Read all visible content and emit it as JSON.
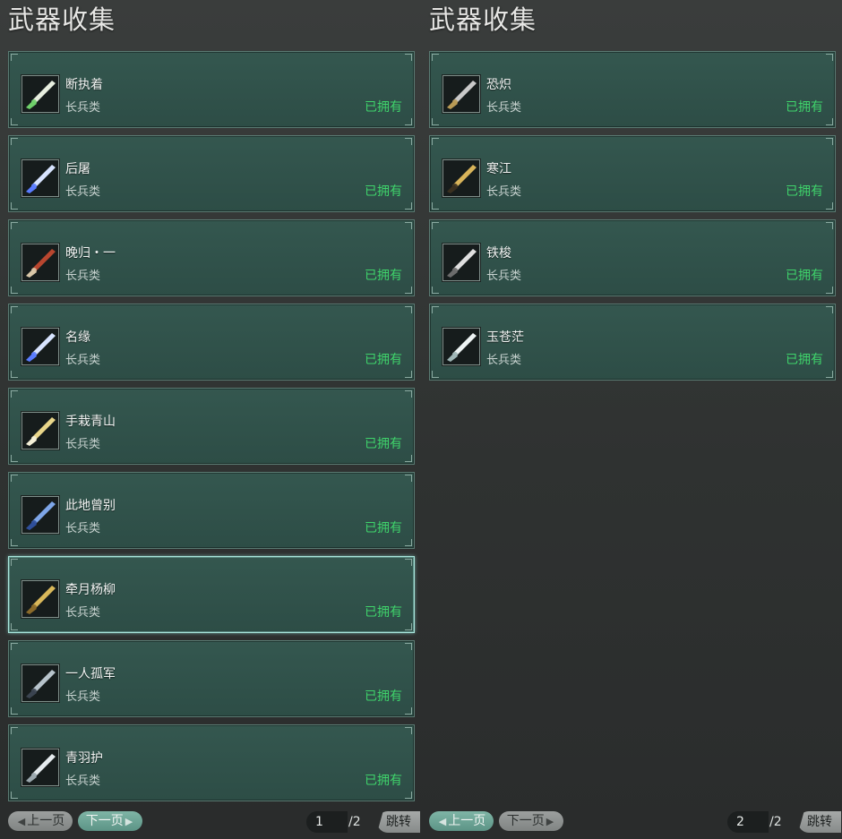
{
  "left_panel": {
    "title": "武器收集",
    "items": [
      {
        "name": "断执着",
        "category": "长兵类",
        "status": "已拥有",
        "icon": "green-bone-blade-icon",
        "selected": false
      },
      {
        "name": "后屠",
        "category": "长兵类",
        "status": "已拥有",
        "icon": "blue-crystal-blade-icon",
        "selected": false
      },
      {
        "name": "晚归・一",
        "category": "长兵类",
        "status": "已拥有",
        "icon": "red-axe-icon",
        "selected": false
      },
      {
        "name": "名缘",
        "category": "长兵类",
        "status": "已拥有",
        "icon": "blue-crystal-blade-icon",
        "selected": false
      },
      {
        "name": "手栽青山",
        "category": "长兵类",
        "status": "已拥有",
        "icon": "golden-spear-icon",
        "selected": false
      },
      {
        "name": "此地曾别",
        "category": "长兵类",
        "status": "已拥有",
        "icon": "blue-steel-spear-icon",
        "selected": false
      },
      {
        "name": "牵月杨柳",
        "category": "长兵类",
        "status": "已拥有",
        "icon": "gold-claw-spear-icon",
        "selected": true
      },
      {
        "name": "一人孤军",
        "category": "长兵类",
        "status": "已拥有",
        "icon": "dark-spear-icon",
        "selected": false
      },
      {
        "name": "青羽护",
        "category": "长兵类",
        "status": "已拥有",
        "icon": "silver-halberd-icon",
        "selected": false
      }
    ],
    "pager": {
      "prev_label": "上一页",
      "next_label": "下一页",
      "current_page": "1",
      "total_pages": "/2",
      "jump_label": "跳转",
      "prev_enabled": false,
      "next_enabled": true
    }
  },
  "right_panel": {
    "title": "武器收集",
    "items": [
      {
        "name": "恐炽",
        "category": "长兵类",
        "status": "已拥有",
        "icon": "trident-icon",
        "selected": false
      },
      {
        "name": "寒江",
        "category": "长兵类",
        "status": "已拥有",
        "icon": "gold-spear-icon",
        "selected": false
      },
      {
        "name": "铁梭",
        "category": "长兵类",
        "status": "已拥有",
        "icon": "iron-spear-icon",
        "selected": false
      },
      {
        "name": "玉苍茫",
        "category": "长兵类",
        "status": "已拥有",
        "icon": "jade-trident-icon",
        "selected": false
      }
    ],
    "pager": {
      "prev_label": "上一页",
      "next_label": "下一页",
      "current_page": "2",
      "total_pages": "/2",
      "jump_label": "跳转",
      "prev_enabled": true,
      "next_enabled": false
    }
  },
  "colors": {
    "card_bg": "#34574f",
    "owned_text": "#3fd46b",
    "selected_border": "#a9e6dc"
  }
}
